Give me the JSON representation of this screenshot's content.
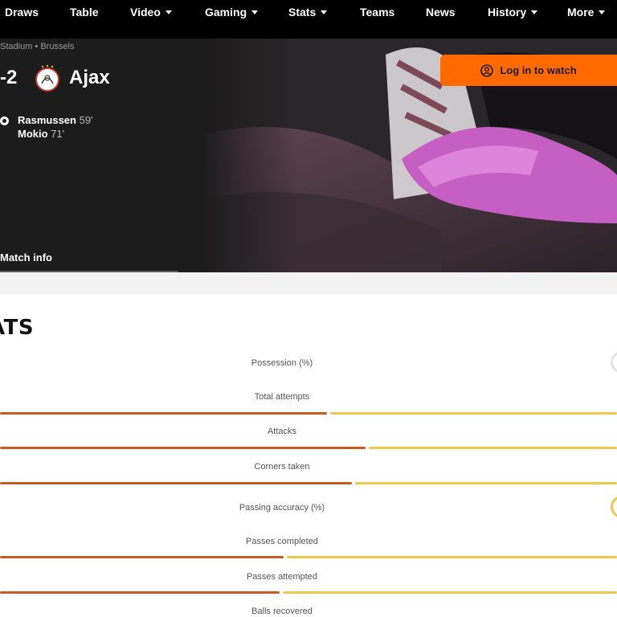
{
  "nav": {
    "items": [
      {
        "label": "Draws",
        "dropdown": false
      },
      {
        "label": "Table",
        "dropdown": false
      },
      {
        "label": "Video",
        "dropdown": true
      },
      {
        "label": "Gaming",
        "dropdown": true
      },
      {
        "label": "Stats",
        "dropdown": true
      },
      {
        "label": "Teams",
        "dropdown": false
      },
      {
        "label": "News",
        "dropdown": false
      },
      {
        "label": "History",
        "dropdown": true
      },
      {
        "label": "More",
        "dropdown": true
      }
    ]
  },
  "match": {
    "venue": "Stadium • Brussels",
    "score": "-2",
    "team": "Ajax",
    "scorers": [
      {
        "name": "Rasmussen",
        "minute": "59'"
      },
      {
        "name": "Mokio",
        "minute": "71'"
      }
    ],
    "match_info_label": "Match info"
  },
  "login": {
    "label": "Log in to watch"
  },
  "stats": {
    "title": "ATS",
    "rows": [
      {
        "label": "Possession (%)",
        "home_fraction": null
      },
      {
        "label": "Total attempts",
        "home_fraction": 0.533
      },
      {
        "label": "Attacks",
        "home_fraction": 0.595
      },
      {
        "label": "Corners taken",
        "home_fraction": 0.573
      },
      {
        "label": "Passing accuracy (%)",
        "home_fraction": null
      },
      {
        "label": "Passes completed",
        "home_fraction": 0.462
      },
      {
        "label": "Passes attempted",
        "home_fraction": 0.456
      },
      {
        "label": "Balls recovered",
        "home_fraction": null
      }
    ]
  },
  "colors": {
    "accent": "#ff6a00",
    "home_bar": "#c75a22",
    "away_bar": "#e8c94a"
  }
}
